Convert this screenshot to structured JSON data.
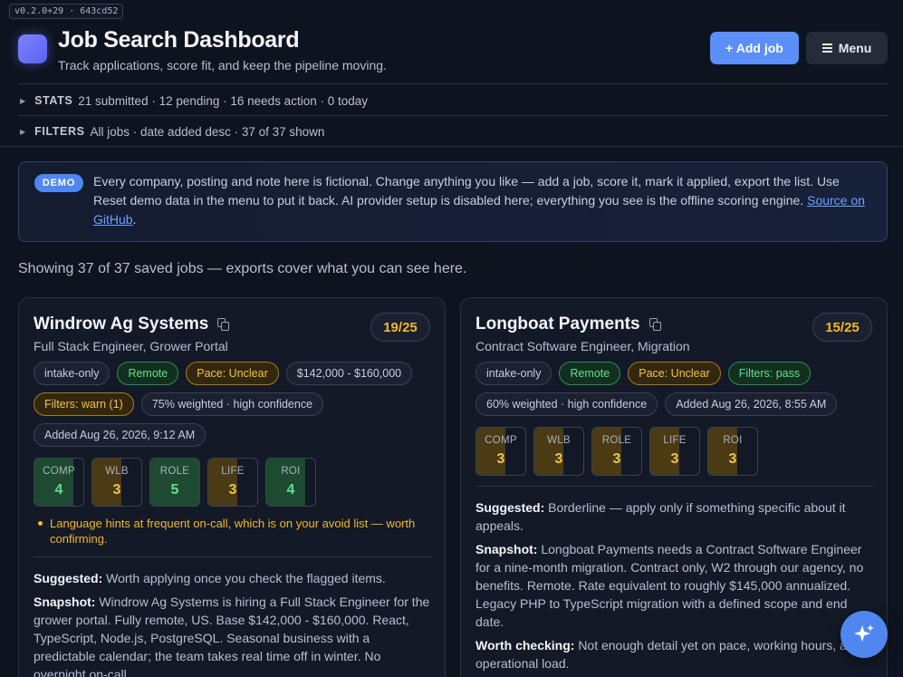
{
  "version": "v0.2.0+29 · 643cd52",
  "header": {
    "title": "Job Search Dashboard",
    "subtitle": "Track applications, score fit, and keep the pipeline moving.",
    "add_label": "+ Add job",
    "menu_label": "Menu"
  },
  "stats": {
    "key": "STATS",
    "text": "21 submitted · 12 pending · 16 needs action · 0 today"
  },
  "filters": {
    "key": "FILTERS",
    "text": "All jobs · date added desc · 37 of 37 shown"
  },
  "demo": {
    "badge": "DEMO",
    "text": "Every company, posting and note here is fictional. Change anything you like — add a job, score it, mark it applied, export the list. Use Reset demo data in the menu to put it back. AI provider setup is disabled here; everything you see is the offline scoring engine. ",
    "link_text": "Source on GitHub",
    "link_after": "."
  },
  "showing": "Showing 37 of 37 saved jobs — exports cover what you can see here.",
  "cards": [
    {
      "company": "Windrow Ag Systems",
      "role": "Full Stack Engineer, Grower Portal",
      "score": "19/25",
      "chips": [
        {
          "text": "intake-only",
          "tone": "neutral"
        },
        {
          "text": "Remote",
          "tone": "green"
        },
        {
          "text": "Pace: Unclear",
          "tone": "amber"
        },
        {
          "text": "$142,000 - $160,000",
          "tone": "neutral"
        },
        {
          "text": "Filters: warn (1)",
          "tone": "amber"
        },
        {
          "text": "75% weighted · high confidence",
          "tone": "neutral"
        },
        {
          "text": "Added Aug 26, 2026, 9:12 AM",
          "tone": "neutral"
        }
      ],
      "metrics": [
        {
          "label": "COMP",
          "value": "4",
          "fraction": 0.8,
          "tone": "green"
        },
        {
          "label": "WLB",
          "value": "3",
          "fraction": 0.6,
          "tone": "amber"
        },
        {
          "label": "ROLE",
          "value": "5",
          "fraction": 1.0,
          "tone": "green"
        },
        {
          "label": "LIFE",
          "value": "3",
          "fraction": 0.6,
          "tone": "amber"
        },
        {
          "label": "ROI",
          "value": "4",
          "fraction": 0.8,
          "tone": "green"
        }
      ],
      "warning": "Language hints at frequent on-call, which is on your avoid list — worth confirming.",
      "suggested_label": "Suggested:",
      "suggested": "Worth applying once you check the flagged items.",
      "snapshot_label": "Snapshot:",
      "snapshot": "Windrow Ag Systems is hiring a Full Stack Engineer for the grower portal. Fully remote, US. Base $142,000 - $160,000. React, TypeScript, Node.js, PostgreSQL. Seasonal business with a predictable calendar; the team takes real time off in winter. No overnight on-call."
    },
    {
      "company": "Longboat Payments",
      "role": "Contract Software Engineer, Migration",
      "score": "15/25",
      "chips": [
        {
          "text": "intake-only",
          "tone": "neutral"
        },
        {
          "text": "Remote",
          "tone": "green"
        },
        {
          "text": "Pace: Unclear",
          "tone": "amber"
        },
        {
          "text": "Filters: pass",
          "tone": "green"
        },
        {
          "text": "60% weighted · high confidence",
          "tone": "neutral"
        },
        {
          "text": "Added Aug 26, 2026, 8:55 AM",
          "tone": "neutral"
        }
      ],
      "metrics": [
        {
          "label": "COMP",
          "value": "3",
          "fraction": 0.6,
          "tone": "amber"
        },
        {
          "label": "WLB",
          "value": "3",
          "fraction": 0.6,
          "tone": "amber"
        },
        {
          "label": "ROLE",
          "value": "3",
          "fraction": 0.6,
          "tone": "amber"
        },
        {
          "label": "LIFE",
          "value": "3",
          "fraction": 0.6,
          "tone": "amber"
        },
        {
          "label": "ROI",
          "value": "3",
          "fraction": 0.6,
          "tone": "amber"
        }
      ],
      "suggested_label": "Suggested:",
      "suggested": "Borderline — apply only if something specific about it appeals.",
      "snapshot_label": "Snapshot:",
      "snapshot": "Longboat Payments needs a Contract Software Engineer for a nine-month migration. Contract only, W2 through our agency, no benefits. Remote. Rate equivalent to roughly $145,000 annualized. Legacy PHP to TypeScript migration with a defined scope and end date.",
      "checking_label": "Worth checking:",
      "checking": "Not enough detail yet on pace, working hours, and operational load."
    }
  ]
}
